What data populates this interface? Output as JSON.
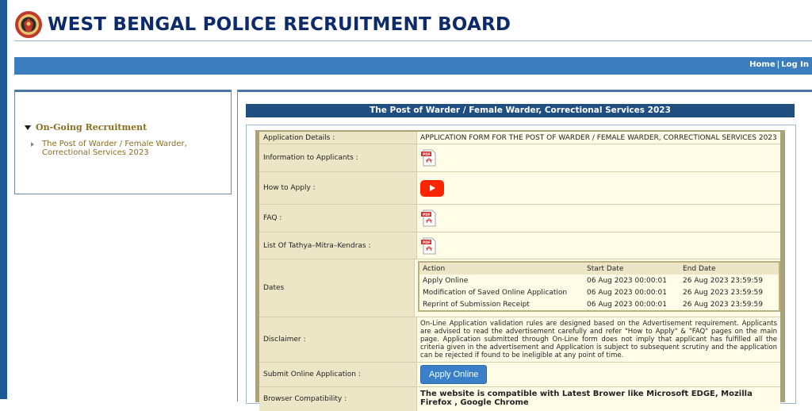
{
  "header": {
    "title": "WEST BENGAL POLICE RECRUITMENT BOARD"
  },
  "nav": {
    "home": "Home",
    "separator": "|",
    "login": "Log In"
  },
  "sidebar": {
    "section_title": "On-Going Recruitment",
    "items": [
      {
        "label": "The Post of Warder / Female Warder, Correctional Services 2023"
      }
    ]
  },
  "main": {
    "post_title": "The Post of Warder / Female Warder, Correctional Services 2023",
    "rows": {
      "application_details": {
        "label": "Application Details :",
        "value": "APPLICATION FORM FOR THE POST OF WARDER / FEMALE WARDER, CORRECTIONAL SERVICES 2023"
      },
      "information": {
        "label": "Information to Applicants :"
      },
      "how_to_apply": {
        "label": "How to Apply :"
      },
      "faq": {
        "label": "FAQ :"
      },
      "tmk": {
        "label": "List Of Tathya–Mitra–Kendras :"
      },
      "dates": {
        "label": "Dates"
      },
      "disclaimer": {
        "label": "Disclaimer :",
        "value": "On-Line Application validation rules are designed based on the Advertisement requirement. Applicants are advised to read the advertisement carefully and refer \"How to Apply\" & \"FAQ\" pages on the main page. Application submitted through On-Line form does not imply that applicant has fulfilled all the criteria given in the advertisement and Application is subject to subsequent scrutiny and the application can be rejected if found to be ineligible at any point of time."
      },
      "submit": {
        "label": "Submit Online Application :",
        "button": "Apply Online"
      },
      "browser": {
        "label": "Browser Compatibility :",
        "value": "The website is compatible with Latest Brower like Microsoft EDGE, Mozilla Firefox , Google Chrome"
      }
    },
    "dates_table": {
      "headers": [
        "Action",
        "Start Date",
        "End Date"
      ],
      "rows": [
        [
          "Apply Online",
          "06 Aug 2023 00:00:01",
          "26 Aug 2023 23:59:59"
        ],
        [
          "Modification of Saved Online Application",
          "06 Aug 2023 00:00:01",
          "26 Aug 2023 23:59:59"
        ],
        [
          "Reprint of Submission Receipt",
          "06 Aug 2023 00:00:01",
          "26 Aug 2023 23:59:59"
        ]
      ]
    }
  },
  "icons": {
    "pdf": "pdf-file-icon",
    "youtube": "youtube-play-icon",
    "logo": "police-emblem-logo"
  },
  "colors": {
    "nav_blue": "#3c7dbd",
    "title_navy": "#0d2b6b",
    "post_bar": "#1f4f82",
    "link_gold": "#8a6d1f",
    "apply_button": "#3a80c8"
  }
}
